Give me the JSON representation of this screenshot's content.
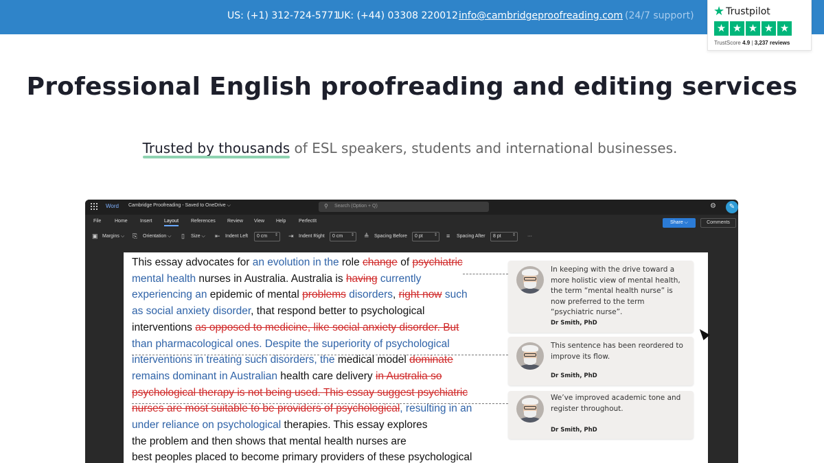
{
  "topbar": {
    "phone_us": "US: (+1) 312-724-5771",
    "phone_uk": "UK: (+44) 03308 220012",
    "email": "info@cambridgeproofreading.com",
    "support": "(24/7 support)"
  },
  "trustpilot": {
    "brand": "Trustpilot",
    "star_glyph": "★",
    "stars": [
      "★",
      "★",
      "★",
      "★",
      "★"
    ],
    "score_label": "TrustScore",
    "score_value": "4.9",
    "reviews": "3,237 reviews",
    "accent": "#00b67a"
  },
  "hero": {
    "title": "Professional English proofreading and editing services",
    "subtitle_highlight": "Trusted by thousands",
    "subtitle_rest": " of ESL speakers, students and international businesses."
  },
  "word": {
    "app_name": "Word",
    "doc_title": "Cambridge Proofreading - Saved to OneDrive ⌵",
    "search_placeholder": "Search (Option + Q)",
    "menu": [
      "File",
      "Home",
      "Insert",
      "Layout",
      "References",
      "Review",
      "View",
      "Help",
      "PerfectIt"
    ],
    "active_menu": "Layout",
    "share_label": "Share ⌵",
    "comments_label": "Comments",
    "ribbon": {
      "margins": "Margins ⌵",
      "orientation": "Orientation ⌵",
      "size": "Size ⌵",
      "indent_left_label": "Indent Left",
      "indent_left_value": "0 cm",
      "indent_right_label": "Indent Right",
      "indent_right_value": "0 cm",
      "spacing_before_label": "Spacing Before",
      "spacing_before_value": "0 pt",
      "spacing_after_label": "Spacing After",
      "spacing_after_value": "8 pt",
      "more": "···"
    }
  },
  "document": {
    "lines": [
      [
        {
          "t": "This essay advocates for ",
          "s": "plain"
        },
        {
          "t": "an evolution in the",
          "s": "add"
        },
        {
          "t": " role ",
          "s": "plain"
        },
        {
          "t": "change",
          "s": "del"
        },
        {
          "t": " of ",
          "s": "plain"
        },
        {
          "t": "psychiatric",
          "s": "del"
        }
      ],
      [
        {
          "t": "mental health",
          "s": "add"
        },
        {
          "t": " nurses in Australia. Australia is ",
          "s": "plain"
        },
        {
          "t": "having",
          "s": "del"
        },
        {
          "t": " ",
          "s": "plain"
        },
        {
          "t": "currently",
          "s": "add"
        }
      ],
      [
        {
          "t": "experiencing an",
          "s": "add"
        },
        {
          "t": " epidemic of mental ",
          "s": "plain"
        },
        {
          "t": "problems",
          "s": "del"
        },
        {
          "t": " ",
          "s": "plain"
        },
        {
          "t": "disorders",
          "s": "add"
        },
        {
          "t": ", ",
          "s": "plain"
        },
        {
          "t": "right now",
          "s": "del"
        },
        {
          "t": " ",
          "s": "plain"
        },
        {
          "t": "such",
          "s": "add"
        }
      ],
      [
        {
          "t": "as social anxiety disorder",
          "s": "add"
        },
        {
          "t": ", that respond better to psychological",
          "s": "plain"
        }
      ],
      [
        {
          "t": "interventions ",
          "s": "plain"
        },
        {
          "t": "as opposed to medicine, like social anxiety disorder. But",
          "s": "del"
        }
      ],
      [
        {
          "t": "than pharmacological ones. Despite the superiority of psychological",
          "s": "add"
        }
      ],
      [
        {
          "t": "interventions in treating such disorders, the",
          "s": "add"
        },
        {
          "t": " medical model ",
          "s": "plain"
        },
        {
          "t": "dominate",
          "s": "del"
        }
      ],
      [
        {
          "t": "remains dominant in Australian",
          "s": "add"
        },
        {
          "t": " health care delivery ",
          "s": "plain"
        },
        {
          "t": "in Australia so",
          "s": "del"
        }
      ],
      [
        {
          "t": "psychological therapy is not being used. This essay suggest psychiatric",
          "s": "del"
        }
      ],
      [
        {
          "t": "nurses are most suitable to be providers of psychological",
          "s": "del"
        },
        {
          "t": ", resulting in an",
          "s": "add"
        }
      ],
      [
        {
          "t": "under reliance on psychological",
          "s": "add"
        },
        {
          "t": " therapies. This essay explores",
          "s": "plain"
        }
      ],
      [
        {
          "t": "the problem and then shows that mental health nurses are",
          "s": "plain"
        }
      ],
      [
        {
          "t": "best peoples placed to become primary providers of these psychological",
          "s": "plain"
        }
      ]
    ],
    "comments": [
      {
        "text": "In keeping with the drive toward a more holistic view of mental health, the term “mental health nurse” is now preferred to the term “psychiatric nurse”.",
        "author": "Dr Smith, PhD"
      },
      {
        "text": "This sentence has been reordered to improve its flow.",
        "author": "Dr Smith, PhD"
      },
      {
        "text": "We’ve improved academic tone and register throughout.",
        "author": "Dr Smith, PhD"
      }
    ]
  }
}
